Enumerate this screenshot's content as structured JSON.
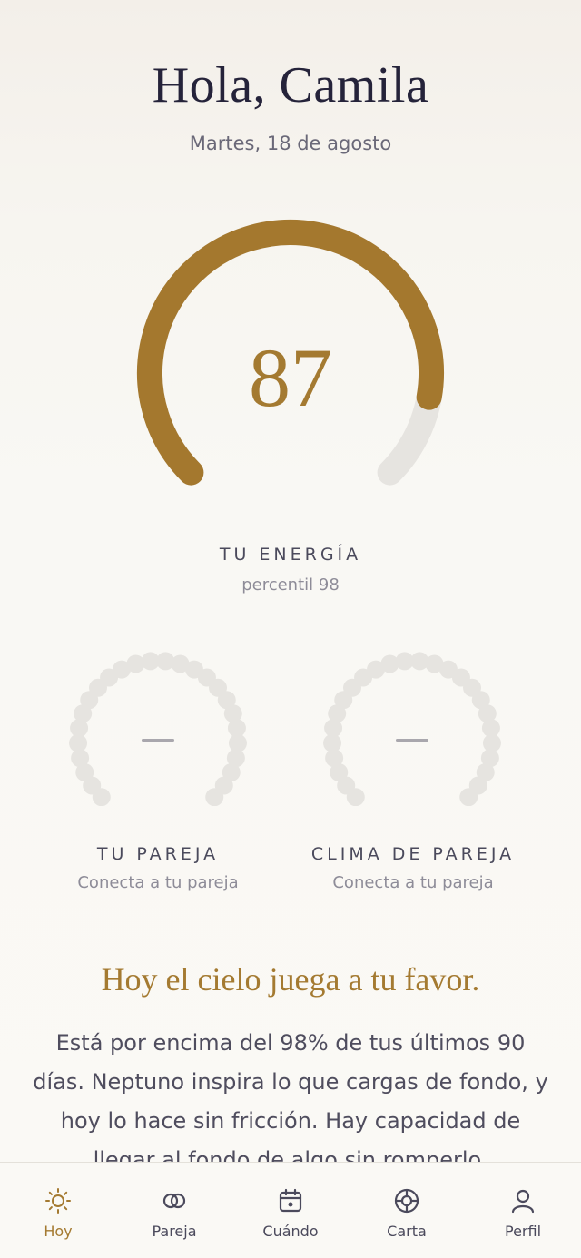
{
  "header": {
    "greeting": "Hola, Camila",
    "date": "Martes, 18 de agosto"
  },
  "energy": {
    "value": "87",
    "label": "TU ENERGÍA",
    "sublabel": "percentil 98",
    "progress_fraction": 0.87,
    "fill_color": "#a4782e",
    "track_color": "#e6e4e0"
  },
  "partner": {
    "value": "—",
    "label": "TU PAREJA",
    "sublabel": "Conecta a tu pareja"
  },
  "climate": {
    "value": "—",
    "label": "CLIMA DE PAREJA",
    "sublabel": "Conecta a tu pareja"
  },
  "insight": {
    "headline": "Hoy el cielo juega a tu favor.",
    "body": "Está por encima del 98% de tus últimos 90 días. Neptuno inspira lo que cargas de fondo, y hoy lo hace sin fricción. Hay capacidad de llegar al fondo de algo sin romperlo."
  },
  "tabs": [
    {
      "label": "Hoy",
      "icon": "sun-icon",
      "active": true
    },
    {
      "label": "Pareja",
      "icon": "rings-icon",
      "active": false
    },
    {
      "label": "Cuándo",
      "icon": "calendar-icon",
      "active": false
    },
    {
      "label": "Carta",
      "icon": "chart-wheel-icon",
      "active": false
    },
    {
      "label": "Perfil",
      "icon": "person-icon",
      "active": false
    }
  ],
  "colors": {
    "accent": "#a47a31",
    "text_dark": "#25233a",
    "text_muted": "#8e8c98"
  }
}
